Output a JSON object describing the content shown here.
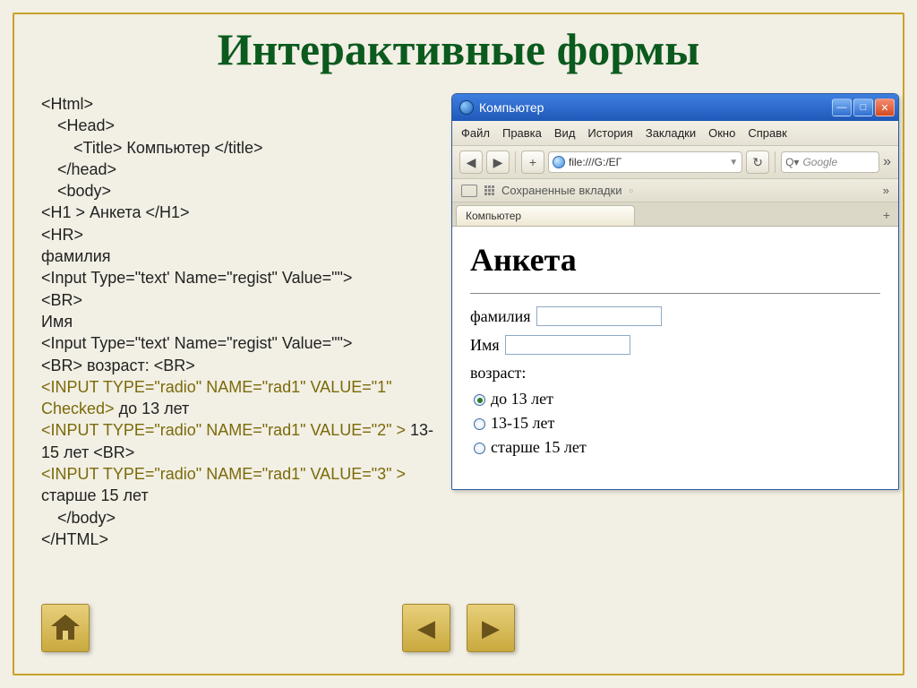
{
  "title": "Интерактивные формы",
  "code": {
    "l1": "<Html>",
    "l2": "<Head>",
    "l3": "<Title> Компьютер </title>",
    "l4": "</head>",
    "l5": "<body>",
    "l6": "<H1 > Анкета </H1>",
    "l7": "<HR>",
    "l8": "фамилия",
    "l9": "<Input Type=\"text' Name=\"regist\" Value=\"\">",
    "l10": "<BR>",
    "l11": "Имя",
    "l12": "<Input Type=\"text' Name=\"regist\" Value=\"\">",
    "l13": "<BR> возраст: <BR>",
    "l14": "<INPUT TYPE=\"radio\" NAME=\"rad1\" VALUE=\"1\" Checked>",
    "l14b": " до 13 лет",
    "l15": "<INPUT TYPE=\"radio\" NAME=\"rad1\" VALUE=\"2\" >",
    "l15b": " 13-15 лет ",
    "l15c": "<BR>",
    "l16": "<INPUT TYPE=\"radio\" NAME=\"rad1\" VALUE=\"3\" >",
    "l16b": " старше 15 лет",
    "l17": "</body>",
    "l18": "</HTML>"
  },
  "browser": {
    "window_title": "Компьютер",
    "menu": [
      "Файл",
      "Правка",
      "Вид",
      "История",
      "Закладки",
      "Окно",
      "Справк"
    ],
    "url": "file:///G:/ЕГ",
    "search_placeholder": "Google",
    "bookmarks_label": "Сохраненные вкладки",
    "tab": "Компьютер",
    "chev": "»"
  },
  "page": {
    "h1": "Анкета",
    "field_surname": "фамилия",
    "field_name": "Имя",
    "age_label": "возраст:",
    "radios": [
      "до 13 лет",
      "13-15 лет",
      "старше 15 лет"
    ]
  }
}
